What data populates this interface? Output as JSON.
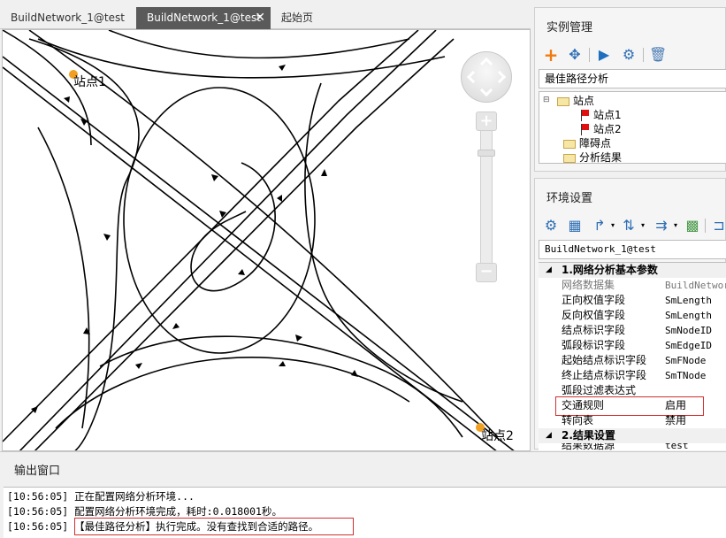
{
  "tabs": [
    {
      "label": "BuildNetwork_1@test",
      "active": false
    },
    {
      "label": "BuildNetwork_1@test",
      "active": true,
      "close": "✕"
    },
    {
      "label": "起始页",
      "active": false
    }
  ],
  "map": {
    "site_labels": [
      "站点1",
      "站点2"
    ],
    "site_color": "#f0a020",
    "zoom_in": "+",
    "zoom_out": "−"
  },
  "instance_panel": {
    "title": "实例管理",
    "toolbar": [
      "add-icon",
      "move-icon",
      "run-icon",
      "settings-icon",
      "delete-icon"
    ],
    "analysis_type": "最佳路径分析",
    "tree": {
      "root": "站点",
      "children": [
        "站点1",
        "站点2"
      ],
      "barriers": "障碍点",
      "results": "分析结果"
    }
  },
  "env_panel": {
    "title": "环境设置",
    "network": "BuildNetwork_1@test",
    "categories": {
      "basic": "1.网络分析基本参数",
      "result": "2.结果设置"
    },
    "properties": [
      {
        "name": "网络数据集",
        "value": "BuildNetwork",
        "muted": true
      },
      {
        "name": "正向权值字段",
        "value": "SmLength"
      },
      {
        "name": "反向权值字段",
        "value": "SmLength"
      },
      {
        "name": "结点标识字段",
        "value": "SmNodeID"
      },
      {
        "name": "弧段标识字段",
        "value": "SmEdgeID"
      },
      {
        "name": "起始结点标识字段",
        "value": "SmFNode"
      },
      {
        "name": "终止结点标识字段",
        "value": "SmTNode"
      },
      {
        "name": "弧段过滤表达式",
        "value": ""
      },
      {
        "name": "交通规则",
        "value": "启用"
      },
      {
        "name": "转向表",
        "value": "禁用"
      }
    ],
    "result_first": {
      "name": "结果数据源",
      "value": "test"
    }
  },
  "output": {
    "title": "输出窗口",
    "lines": [
      "[10:56:05] 正在配置网络分析环境...",
      "[10:56:05] 配置网络分析环境完成，耗时:0.018001秒。",
      "[10:56:05] 【最佳路径分析】执行完成。没有查找到合适的路径。"
    ]
  },
  "colors": {
    "highlight": "#d23030",
    "active_tab": "#5a5a5a"
  }
}
